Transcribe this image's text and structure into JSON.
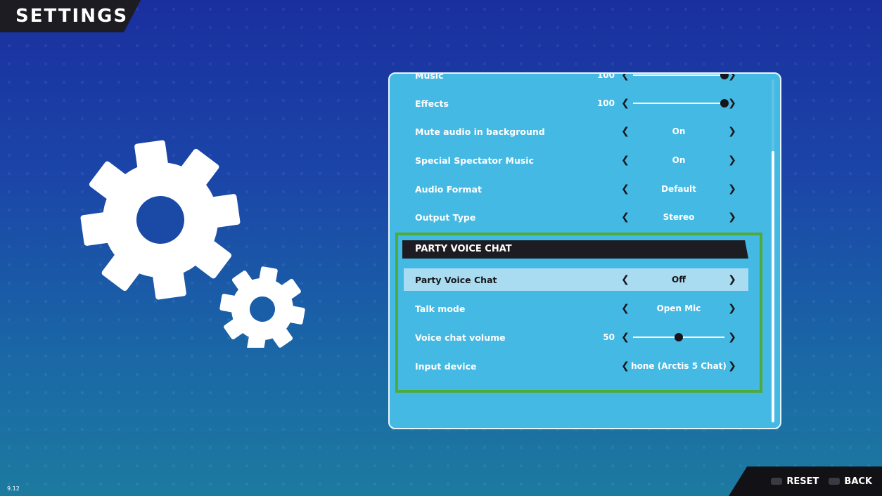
{
  "header": {
    "title": "SETTINGS"
  },
  "audio": {
    "music": {
      "label": "Music",
      "value": "100",
      "level": 1.0
    },
    "effects": {
      "label": "Effects",
      "value": "100",
      "level": 1.0
    },
    "mute_bg": {
      "label": "Mute audio in background",
      "value": "On"
    },
    "spectator": {
      "label": "Special Spectator Music",
      "value": "On"
    },
    "format": {
      "label": "Audio Format",
      "value": "Default"
    },
    "output": {
      "label": "Output Type",
      "value": "Stereo"
    }
  },
  "party": {
    "header": "PARTY VOICE CHAT",
    "voice_chat": {
      "label": "Party Voice Chat",
      "value": "Off"
    },
    "talk_mode": {
      "label": "Talk mode",
      "value": "Open Mic"
    },
    "volume": {
      "label": "Voice chat volume",
      "value": "50",
      "level": 0.5
    },
    "input": {
      "label": "Input device",
      "value": "hone (Arctis 5 Chat)"
    }
  },
  "footer": {
    "reset_label": "RESET",
    "back_label": "BACK",
    "version": "9.12"
  },
  "colors": {
    "panel": "#44b9e3",
    "highlight_border": "#4daa3b",
    "dark": "#1c1c22"
  }
}
